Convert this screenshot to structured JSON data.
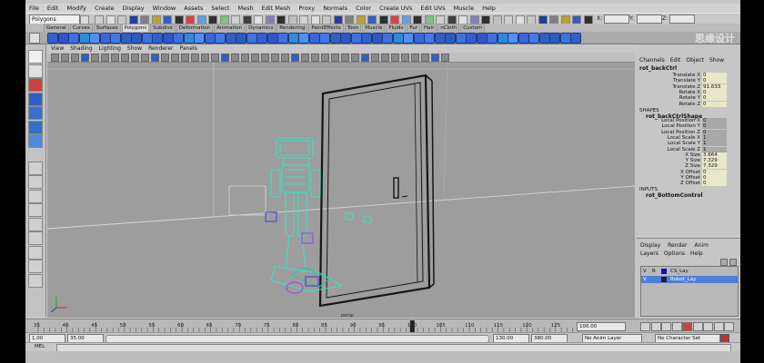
{
  "menubar": [
    "File",
    "Edit",
    "Modify",
    "Create",
    "Display",
    "Window",
    "Assets",
    "Select",
    "Mesh",
    "Edit Mesh",
    "Proxy",
    "Normals",
    "Color",
    "Create UVs",
    "Edit UVs",
    "Muscle",
    "Help"
  ],
  "status_line": {
    "menu_set": "Polygons",
    "field_x_label": "X:",
    "field_y_label": "Y:",
    "field_z_label": "Z:"
  },
  "shelf_tabs": [
    "General",
    "Curves",
    "Surfaces",
    "Polygons",
    "Subdivs",
    "Deformation",
    "Animation",
    "Dynamics",
    "Rendering",
    "PaintEffects",
    "Toon",
    "Muscle",
    "Fluids",
    "Fur",
    "Hair",
    "nCloth",
    "Custom"
  ],
  "active_shelf": "Polygons",
  "watermark": "思缘设计",
  "panel_menu": [
    "View",
    "Shading",
    "Lighting",
    "Show",
    "Renderer",
    "Panels"
  ],
  "viewport": {
    "hud_label": "persp"
  },
  "channel_box": {
    "menu": [
      "Channels",
      "Edit",
      "Object",
      "Show"
    ],
    "object_name": "rot_backCtrl",
    "transform_attrs": [
      {
        "name": "Translate X",
        "value": "0"
      },
      {
        "name": "Translate Y",
        "value": "0"
      },
      {
        "name": "Translate Z",
        "value": "91.633"
      },
      {
        "name": "Rotate X",
        "value": "0"
      },
      {
        "name": "Rotate Y",
        "value": "0"
      },
      {
        "name": "Rotate Z",
        "value": "0"
      }
    ],
    "shapes_header": "SHAPES",
    "shape_name": "rot_backCtrlShape",
    "shape_attrs": [
      {
        "name": "Local Position X",
        "value": "0"
      },
      {
        "name": "Local Position Y",
        "value": "0"
      },
      {
        "name": "Local Position Z",
        "value": "0"
      },
      {
        "name": "Local Scale X",
        "value": "1"
      },
      {
        "name": "Local Scale Y",
        "value": "1"
      },
      {
        "name": "Local Scale Z",
        "value": "1"
      },
      {
        "name": "X Size",
        "value": "3.664"
      },
      {
        "name": "Y Size",
        "value": "7.329"
      },
      {
        "name": "Z Size",
        "value": "7.329"
      },
      {
        "name": "X Offset",
        "value": "0"
      },
      {
        "name": "Y Offset",
        "value": "0"
      },
      {
        "name": "Z Offset",
        "value": "0"
      }
    ],
    "inputs_header": "INPUTS",
    "input_name": "rot_BottomControl"
  },
  "layer_editor": {
    "modes": [
      "Display",
      "Render",
      "Anim"
    ],
    "menu": [
      "Layers",
      "Options",
      "Help"
    ],
    "layers": [
      {
        "v": "V",
        "r": "R",
        "name": "CS_Lay",
        "color": "#1010c0",
        "selected": false
      },
      {
        "v": "V",
        "r": "",
        "name": "Robot_Lay",
        "color": "#202020",
        "selected": true
      }
    ]
  },
  "time_slider": {
    "ticks": [
      "35",
      "40",
      "45",
      "50",
      "55",
      "60",
      "65",
      "70",
      "75",
      "80",
      "85",
      "90",
      "95",
      "100",
      "105",
      "110",
      "115",
      "120",
      "125"
    ],
    "current_frame": "100.00"
  },
  "range_slider": {
    "start": "1.00",
    "range_start": "35.00",
    "range_end": "130.00",
    "end": "380.00",
    "anim_layer": "No Anim Layer",
    "char_set": "No Character Set"
  },
  "command_line": {
    "label": "MEL"
  },
  "colors": {
    "wire_cyan": "#33e6c4",
    "wire_teal": "#20c8a8",
    "rig_blue": "#3a3ae0",
    "rig_purple": "#9a40e0",
    "viewport_bg": "#9d9d9d"
  }
}
